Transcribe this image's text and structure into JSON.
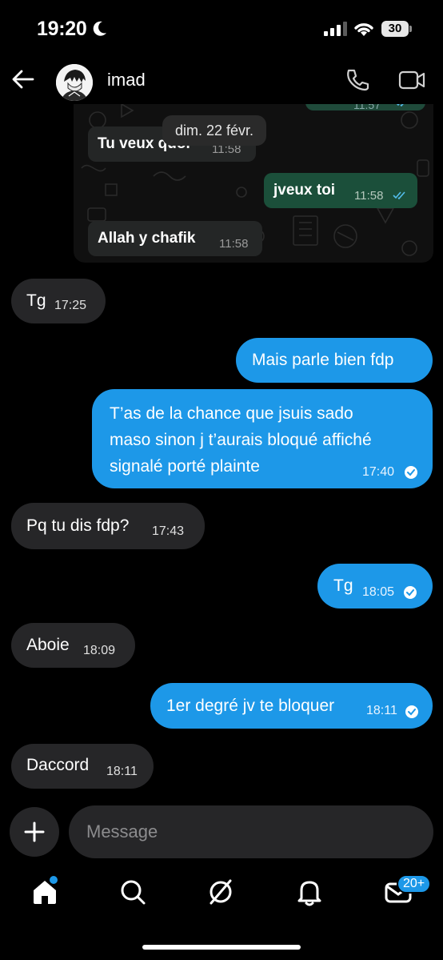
{
  "status_bar": {
    "time": "19:20",
    "battery": "30"
  },
  "header": {
    "contact_name": "imad"
  },
  "embedded_screenshot": {
    "top_time": "11:57",
    "date_separator": "dim. 22 févr.",
    "messages": [
      {
        "direction": "in",
        "text": "Tu veux quoi",
        "time": "11:58"
      },
      {
        "direction": "out",
        "text": "jveux toi",
        "time": "11:58"
      },
      {
        "direction": "in",
        "text": "Allah y chafik",
        "time": "11:58"
      }
    ]
  },
  "messages": [
    {
      "direction": "in",
      "text": "Tg",
      "time": "17:25"
    },
    {
      "direction": "out",
      "text": "Mais parle bien fdp",
      "time": ""
    },
    {
      "direction": "out",
      "lines": [
        "T’as de la chance que jsuis sado",
        "maso sinon j t’aurais bloqué affiché",
        "signalé porté plainte"
      ],
      "time": "17:40"
    },
    {
      "direction": "in",
      "text": "Pq tu dis fdp?",
      "time": "17:43"
    },
    {
      "direction": "out",
      "text": "Tg",
      "time": "18:05"
    },
    {
      "direction": "in",
      "text": "Aboie",
      "time": "18:09"
    },
    {
      "direction": "out",
      "text": "1er degré jv te bloquer",
      "time": "18:11"
    },
    {
      "direction": "in",
      "text": "Daccord",
      "time": "18:11"
    }
  ],
  "composer": {
    "placeholder": "Message"
  },
  "tab_bar": {
    "items": [
      "home-icon",
      "search-icon",
      "explore-icon",
      "notifications-icon",
      "inbox-icon"
    ],
    "inbox_badge": "20+"
  },
  "colors": {
    "accent": "#1d98e8",
    "incoming_bubble": "#262628",
    "background": "#000000"
  }
}
